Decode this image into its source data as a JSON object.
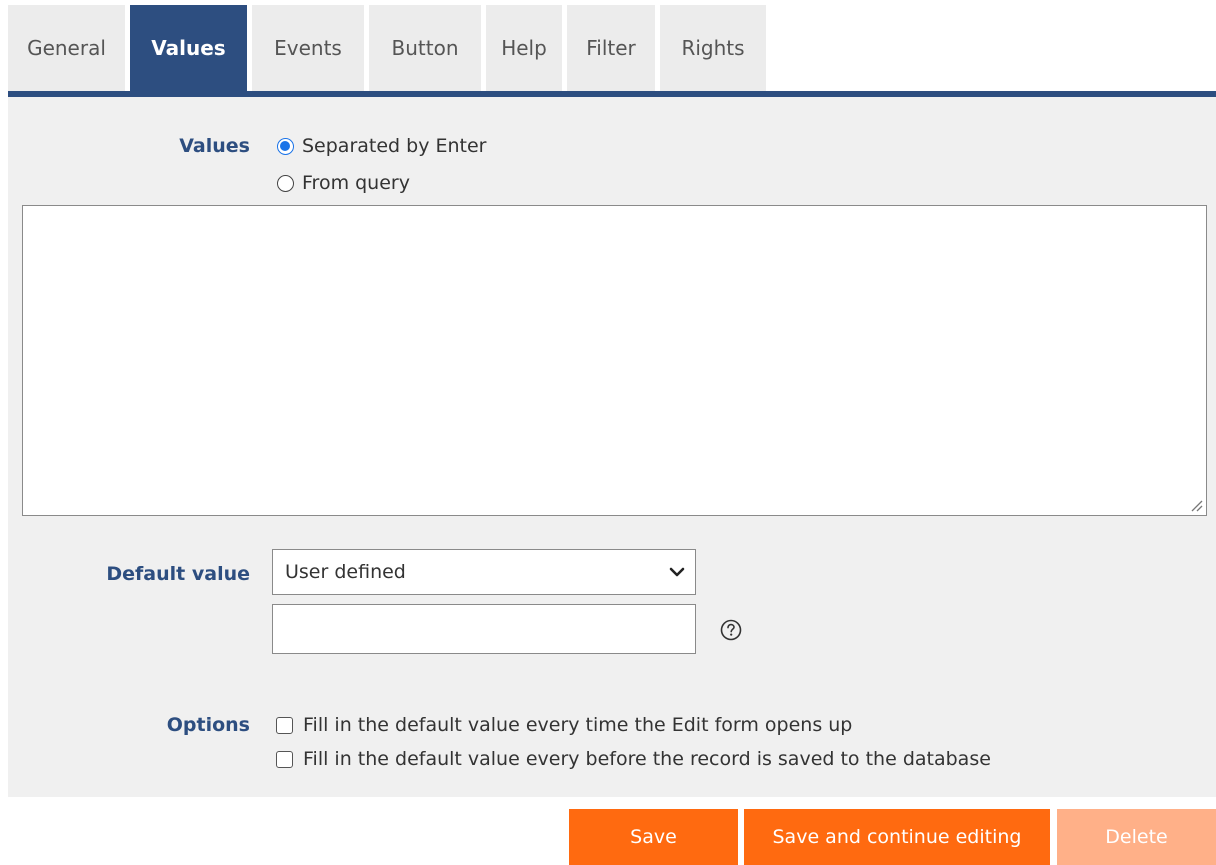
{
  "tabs": [
    {
      "label": "General",
      "active": false
    },
    {
      "label": "Values",
      "active": true
    },
    {
      "label": "Events",
      "active": false
    },
    {
      "label": "Button",
      "active": false
    },
    {
      "label": "Help",
      "active": false
    },
    {
      "label": "Filter",
      "active": false
    },
    {
      "label": "Rights",
      "active": false
    }
  ],
  "values_section": {
    "label": "Values",
    "options": [
      {
        "label": "Separated by Enter",
        "checked": true
      },
      {
        "label": "From query",
        "checked": false
      }
    ],
    "textarea_value": ""
  },
  "default_value": {
    "label": "Default value",
    "selected": "User defined",
    "input_value": "",
    "help_icon": "question-circle-icon"
  },
  "options_section": {
    "label": "Options",
    "checkboxes": [
      {
        "label": "Fill in the default value every time the Edit form opens up",
        "checked": false
      },
      {
        "label": "Fill in the default value every before the record is saved to the database",
        "checked": false
      }
    ]
  },
  "buttons": {
    "save": "Save",
    "save_continue": "Save and continue editing",
    "delete": "Delete"
  },
  "colors": {
    "accent": "#2d4e80",
    "primary_button": "#ff6a10",
    "disabled_button": "#ffb088",
    "panel_bg": "#f0f0f0"
  }
}
